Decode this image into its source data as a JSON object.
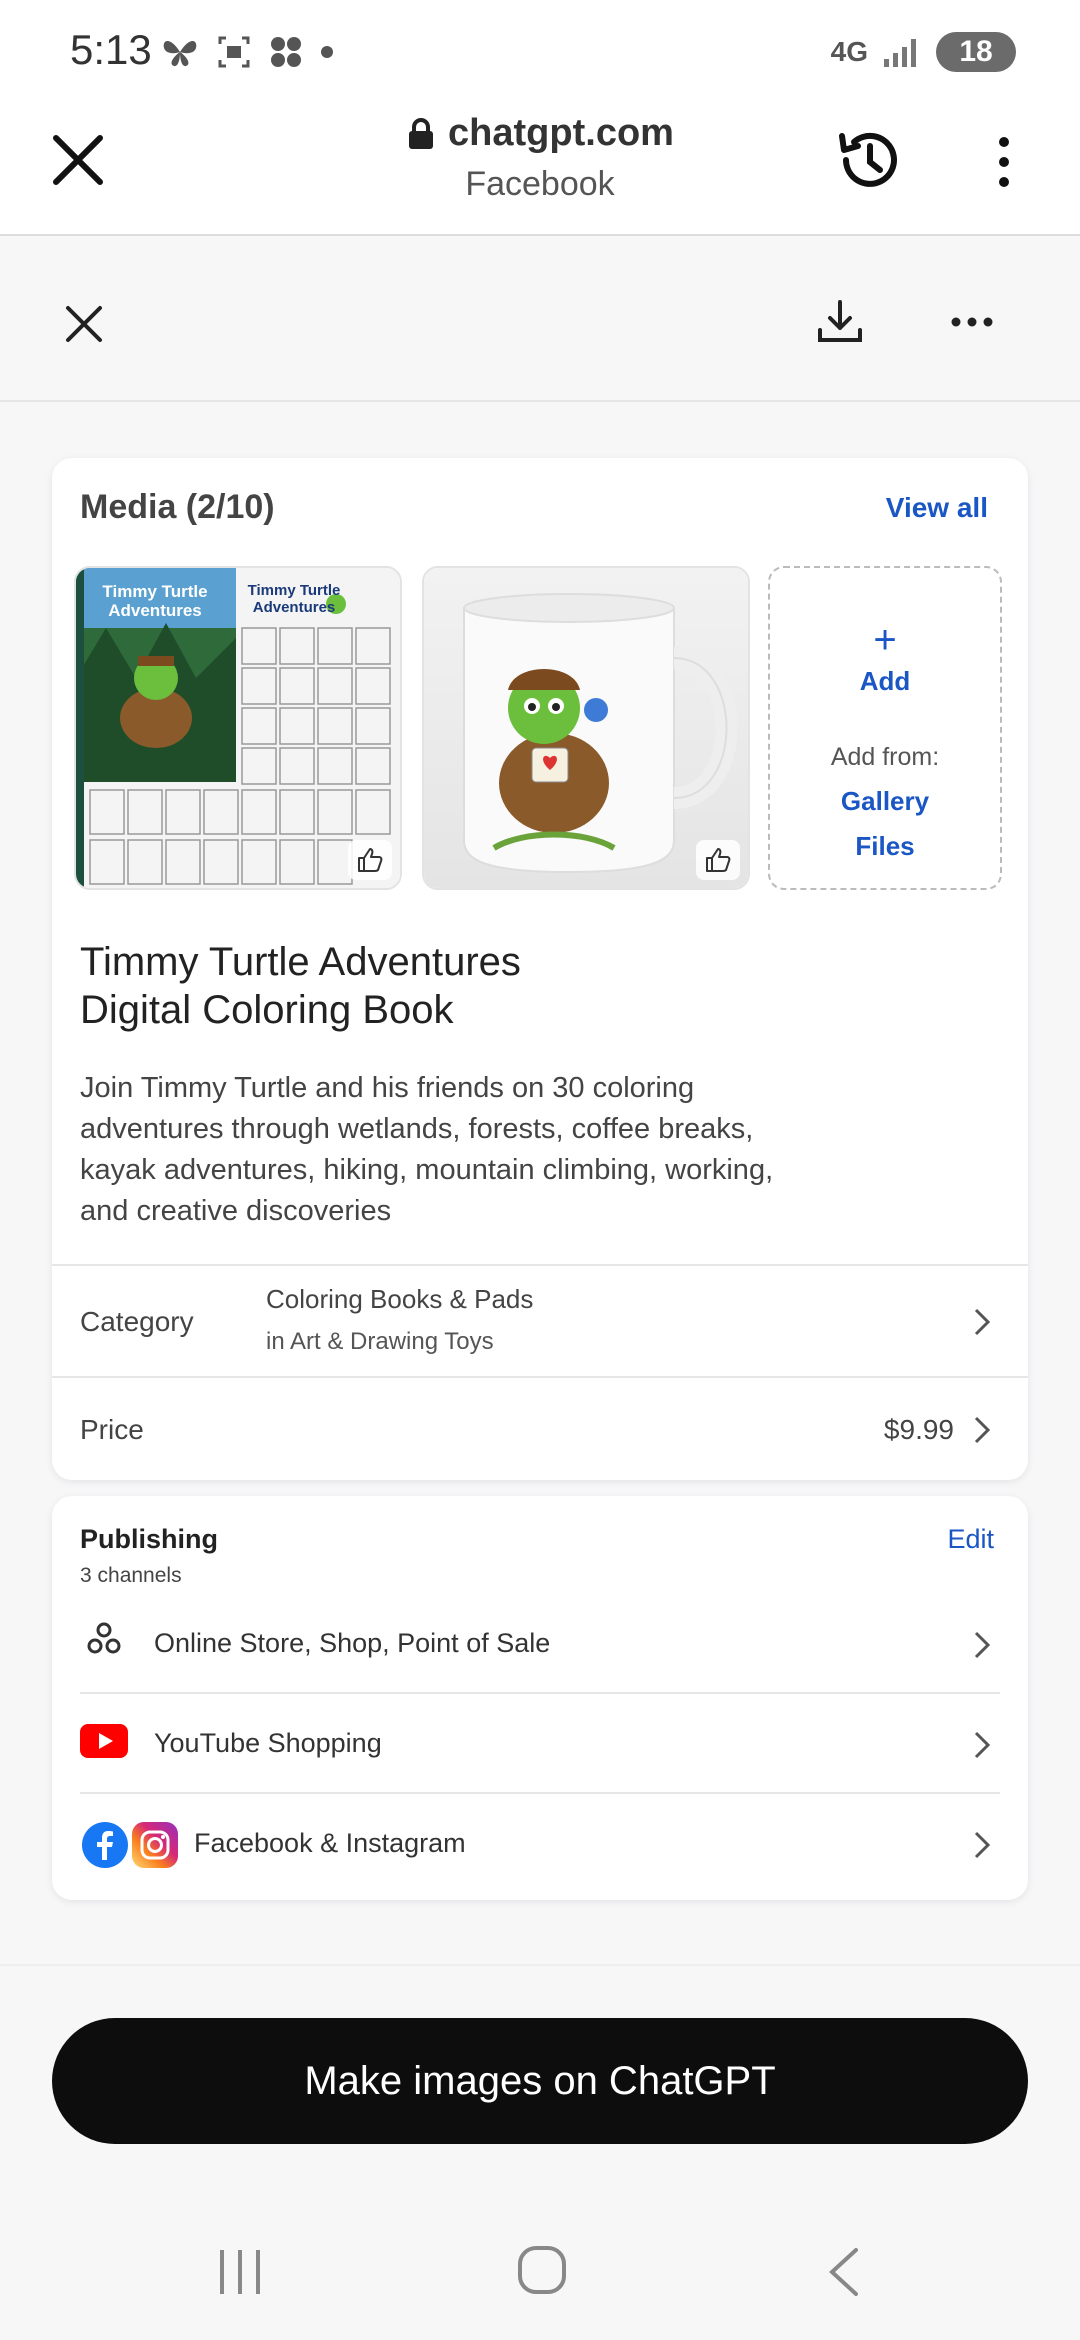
{
  "status_bar": {
    "time": "5:13",
    "network": "4G",
    "battery": "18"
  },
  "browser": {
    "url": "chatgpt.com",
    "source": "Facebook"
  },
  "media": {
    "heading": "Media (2/10)",
    "view_all": "View all",
    "thumb1_title": "Timmy Turtle Adventures",
    "thumb1_subtitle": "Timmy Turtle Adventures",
    "add_label": "Add",
    "add_from_label": "Add from:",
    "add_sources": [
      "Gallery",
      "Files"
    ]
  },
  "product": {
    "title_line1": "Timmy Turtle Adventures",
    "title_line2": "Digital Coloring Book",
    "description": "Join Timmy Turtle and his friends on 30 coloring adventures through wetlands, forests, coffee breaks, kayak adventures, hiking, mountain climbing, working, and creative discoveries",
    "category_label": "Category",
    "category_main": "Coloring Books & Pads",
    "category_sub": "in Art & Drawing Toys",
    "price_label": "Price",
    "price_value": "$9.99"
  },
  "publishing": {
    "title": "Publishing",
    "subtitle": "3 channels",
    "edit_label": "Edit",
    "channels": [
      {
        "label": "Online Store, Shop, Point of Sale",
        "icon": "shop-channels-icon"
      },
      {
        "label": "YouTube Shopping",
        "icon": "youtube-icon"
      },
      {
        "label": "Facebook & Instagram",
        "icon": "facebook-instagram-icon"
      }
    ]
  },
  "cta": {
    "label": "Make images on ChatGPT"
  },
  "colors": {
    "link_blue": "#1a56c4",
    "cta_black": "#0d0d0d",
    "youtube_red": "#ff0000",
    "facebook_blue": "#1877f2"
  }
}
